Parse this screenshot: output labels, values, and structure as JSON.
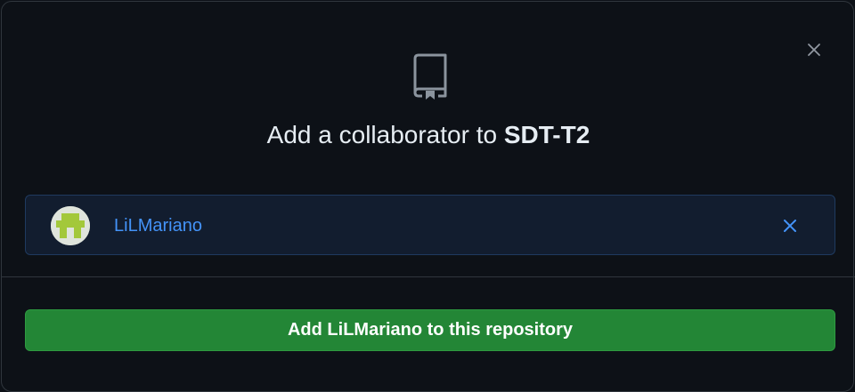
{
  "dialog": {
    "title_prefix": "Add a collaborator to ",
    "repo_name": "SDT-T2",
    "close_icon": "close-icon",
    "header_icon": "repo-icon"
  },
  "selected_user": {
    "username": "LiLMariano",
    "avatar_icon": "avatar",
    "remove_icon": "close-icon",
    "link_color": "#4493f8"
  },
  "action": {
    "button_label": "Add LiLMariano to this repository",
    "button_color": "#238636"
  },
  "theme": {
    "background": "#0d1117",
    "text": "#e6edf3",
    "border": "#30363d"
  }
}
